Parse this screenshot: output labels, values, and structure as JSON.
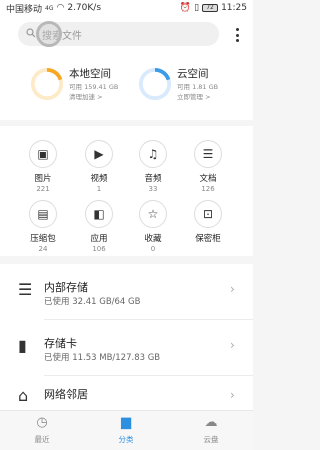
{
  "status_bar": {
    "carrier": "中国移动",
    "network_badge": "4G",
    "speed": "2.70K/s",
    "battery": "72",
    "time": "11:25"
  },
  "search": {
    "placeholder": "搜索文件"
  },
  "storage": {
    "local": {
      "name": "本地空间",
      "available": "可用 159.41 GB",
      "action": "清理加速 >",
      "used_fraction": 0.2
    },
    "cloud": {
      "name": "云空间",
      "available": "可用 1.81 GB",
      "action": "立即管理 >",
      "used_fraction": 0.2
    }
  },
  "categories": [
    {
      "label": "图片",
      "count": "221",
      "icon": "image-icon"
    },
    {
      "label": "视频",
      "count": "1",
      "icon": "video-icon"
    },
    {
      "label": "音频",
      "count": "33",
      "icon": "audio-icon"
    },
    {
      "label": "文档",
      "count": "126",
      "icon": "document-icon"
    },
    {
      "label": "压缩包",
      "count": "24",
      "icon": "archive-icon"
    },
    {
      "label": "应用",
      "count": "106",
      "icon": "app-icon"
    },
    {
      "label": "收藏",
      "count": "0",
      "icon": "favorite-icon"
    },
    {
      "label": "保密柜",
      "count": "",
      "icon": "safe-icon"
    }
  ],
  "locations": [
    {
      "title": "内部存储",
      "detail": "已使用 32.41 GB/64 GB",
      "icon": "storage-icon"
    },
    {
      "title": "存储卡",
      "detail": "已使用 11.53 MB/127.83 GB",
      "icon": "sd-card-icon"
    },
    {
      "title": "网络邻居",
      "detail": "",
      "icon": "network-icon"
    }
  ],
  "nav": [
    {
      "label": "最近",
      "icon": "clock-icon"
    },
    {
      "label": "分类",
      "icon": "folder-icon"
    },
    {
      "label": "云盘",
      "icon": "cloud-icon"
    }
  ],
  "colors": {
    "accent": "#2d8fe0",
    "local_ring": "#f7a823",
    "cloud_ring": "#3a9be8"
  }
}
